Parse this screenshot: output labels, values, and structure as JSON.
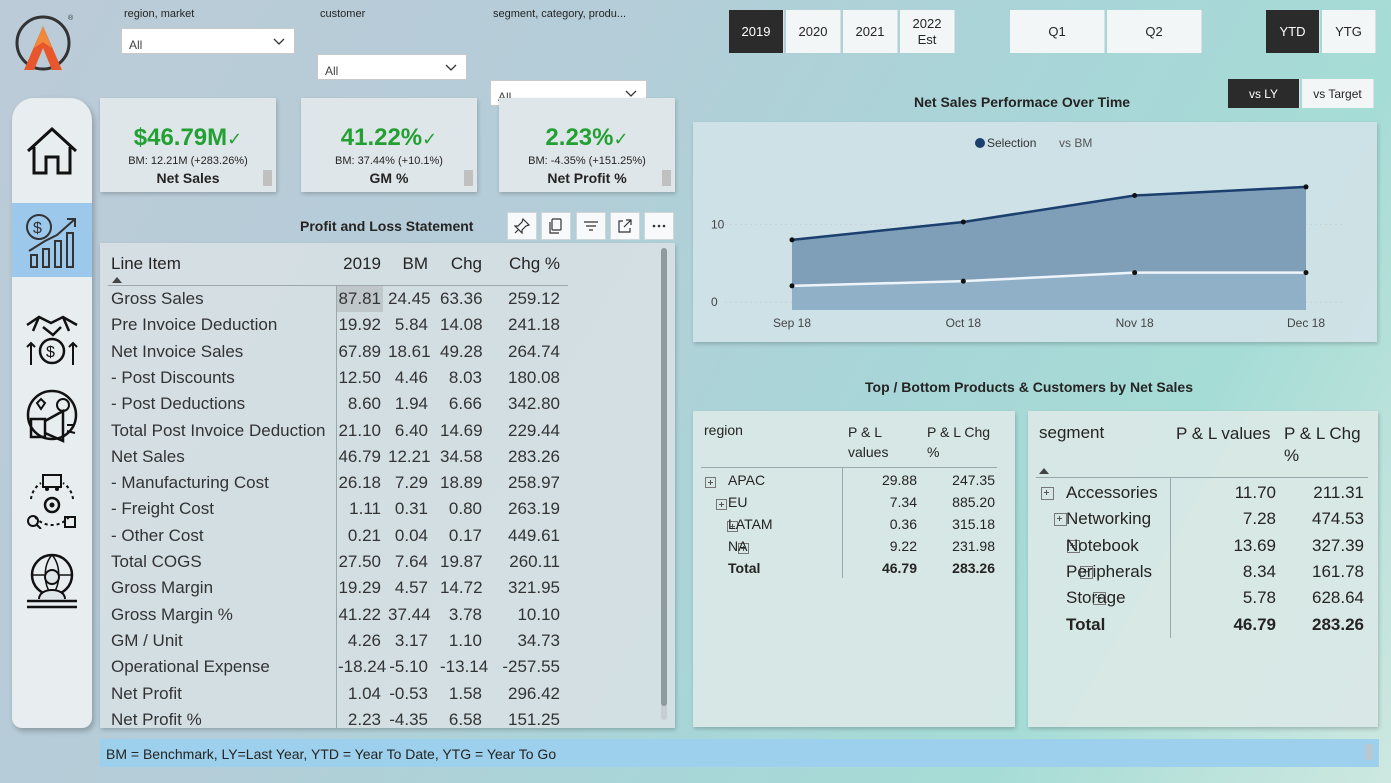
{
  "filters": [
    {
      "label": "region, market",
      "value": "All"
    },
    {
      "label": "customer",
      "value": "All"
    },
    {
      "label": "segment, category, produ...",
      "value": "All"
    }
  ],
  "years": [
    "2019",
    "2020",
    "2021",
    "2022 Est"
  ],
  "selected_year": "2019",
  "quarters": [
    "Q1",
    "Q2"
  ],
  "period": [
    "YTD",
    "YTG"
  ],
  "selected_period": "YTD",
  "compare": [
    "vs LY",
    "vs Target"
  ],
  "selected_compare": "vs LY",
  "nav": [
    "home-icon",
    "finance-growth-icon",
    "handshake-money-icon",
    "marketing-icon",
    "supply-chain-icon",
    "executive-icon"
  ],
  "kpis": [
    {
      "value": "$46.79M",
      "bm": "BM: 12.21M (+283.26%)",
      "label": "Net Sales"
    },
    {
      "value": "41.22%",
      "bm": "BM: 37.44% (+10.1%)",
      "label": "GM %"
    },
    {
      "value": "2.23%",
      "bm": "BM: -4.35% (+151.25%)",
      "label": "Net Profit %"
    }
  ],
  "pl": {
    "title": "Profit and Loss Statement",
    "columns": [
      "Line Item",
      "2019",
      "BM",
      "Chg",
      "Chg %"
    ],
    "rows": [
      [
        "Gross Sales",
        "87.81",
        "24.45",
        "63.36",
        "259.12"
      ],
      [
        "Pre Invoice Deduction",
        "19.92",
        "5.84",
        "14.08",
        "241.18"
      ],
      [
        "Net Invoice Sales",
        "67.89",
        "18.61",
        "49.28",
        "264.74"
      ],
      [
        "- Post Discounts",
        "12.50",
        "4.46",
        "8.03",
        "180.08"
      ],
      [
        "- Post Deductions",
        "8.60",
        "1.94",
        "6.66",
        "342.80"
      ],
      [
        "Total Post Invoice Deduction",
        "21.10",
        "6.40",
        "14.69",
        "229.44"
      ],
      [
        "Net Sales",
        "46.79",
        "12.21",
        "34.58",
        "283.26"
      ],
      [
        "- Manufacturing Cost",
        "26.18",
        "7.29",
        "18.89",
        "258.97"
      ],
      [
        "- Freight Cost",
        "1.11",
        "0.31",
        "0.80",
        "263.19"
      ],
      [
        "- Other Cost",
        "0.21",
        "0.04",
        "0.17",
        "449.61"
      ],
      [
        "Total COGS",
        "27.50",
        "7.64",
        "19.87",
        "260.11"
      ],
      [
        "Gross Margin",
        "19.29",
        "4.57",
        "14.72",
        "321.95"
      ],
      [
        "Gross Margin %",
        "41.22",
        "37.44",
        "3.78",
        "10.10"
      ],
      [
        "GM / Unit",
        "4.26",
        "3.17",
        "1.10",
        "34.73"
      ],
      [
        "Operational Expense",
        "-18.24",
        "-5.10",
        "-13.14",
        "-257.55"
      ],
      [
        "Net Profit",
        "1.04",
        "-0.53",
        "1.58",
        "296.42"
      ],
      [
        "Net Profit %",
        "2.23",
        "-4.35",
        "6.58",
        "151.25"
      ]
    ]
  },
  "chart": {
    "title": "Net Sales Performace Over Time",
    "legend": [
      "Selection",
      "vs BM"
    ],
    "colors": {
      "selection": "#1b3f6e",
      "bm": "#eef4fa",
      "area": "#7f9fb9"
    }
  },
  "chart_data": {
    "type": "area",
    "x": [
      "Sep 18",
      "Oct 18",
      "Nov 18",
      "Dec 18"
    ],
    "series": [
      {
        "name": "Selection",
        "values": [
          8.0,
          10.3,
          13.7,
          14.8
        ]
      },
      {
        "name": "vs BM",
        "values": [
          2.1,
          2.7,
          3.8,
          3.8
        ]
      }
    ],
    "yticks": [
      0,
      10
    ],
    "ylim": [
      -1,
      18
    ],
    "grid": true,
    "legend_position": "top-center"
  },
  "tops_title": "Top / Bottom Products & Customers by Net Sales",
  "region_table": {
    "columns": [
      "region",
      "P & L values",
      "P & L Chg %"
    ],
    "rows": [
      [
        "APAC",
        "29.88",
        "247.35"
      ],
      [
        "EU",
        "7.34",
        "885.20"
      ],
      [
        "LATAM",
        "0.36",
        "315.18"
      ],
      [
        "NA",
        "9.22",
        "231.98"
      ]
    ],
    "total": [
      "Total",
      "46.79",
      "283.26"
    ]
  },
  "segment_table": {
    "columns": [
      "segment",
      "P & L values",
      "P & L Chg %"
    ],
    "rows": [
      [
        "Accessories",
        "11.70",
        "211.31"
      ],
      [
        "Networking",
        "7.28",
        "474.53"
      ],
      [
        "Notebook",
        "13.69",
        "327.39"
      ],
      [
        "Peripherals",
        "8.34",
        "161.78"
      ],
      [
        "Storage",
        "5.78",
        "628.64"
      ]
    ],
    "total": [
      "Total",
      "46.79",
      "283.26"
    ]
  },
  "footer": "BM = Benchmark, LY=Last Year, YTD = Year To Date, YTG = Year To Go"
}
